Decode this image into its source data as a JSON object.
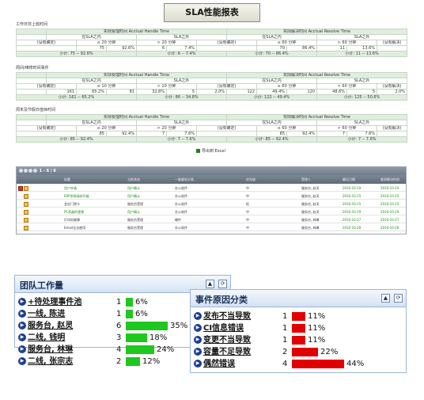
{
  "report": {
    "title": "SLA性能报表",
    "export_label": "导出到 Excel",
    "sections": [
      {
        "heading": "工作日非上班时间",
        "handle_header": "实际受理时间 Acctual Handle Time",
        "resolve_header": "实际解决时间 Acctual Resolve Time",
        "sub": [
          "在SLA之内",
          "SLA之外",
          "在SLA之内",
          "SLA之外"
        ],
        "cols": [
          "(没有确定)",
          "≤ 20 分钟",
          "> 20 分钟",
          "(没有确定)",
          "≤ 60 分钟",
          "> 60 分钟",
          "(没有解决)"
        ],
        "values": [
          "",
          "75",
          "92.6%",
          "6",
          "7.4%",
          "",
          "70",
          "86.4%",
          "11",
          "13.6%",
          ""
        ],
        "totals": [
          "小计: 75 -- 92.6%",
          "小计: 6 -- 7.4%",
          "小计: 70 -- 86.4%",
          "小计: 11 -- 13.6%"
        ]
      },
      {
        "heading": "周间/维修时间事件",
        "handle_header": "实际受理时间 Acctual Handle Time",
        "resolve_header": "实际解决时间 Acctual Resolve Time",
        "sub": [
          "在SLA之内",
          "SLA之外",
          "在SLA之内",
          "SLA之外"
        ],
        "cols": [
          "(没有确定)",
          "≤ 10 分钟",
          "> 10 分钟",
          "(没有确定)",
          "≤ 60 分钟",
          "> 60 分钟",
          "(没有解决)"
        ],
        "values": [
          "",
          "161",
          "65.2%",
          "81",
          "32.8%",
          "5",
          "2.0%",
          "122",
          "49.4%",
          "120",
          "48.6%",
          "5",
          "2.0%"
        ],
        "totals": [
          "小计: 161 -- 65.2%",
          "小计: 86 -- 34.8%",
          "小计: 122 -- 49.4%",
          "小计: 125 -- 50.6%"
        ]
      },
      {
        "heading": "周末及节假日值休时间",
        "handle_header": "实际受理时间 Acctual Handle Time",
        "resolve_header": "实际解决时间 Acctual Resolve Time",
        "sub": [
          "在SLA之内",
          "SLA之外",
          "在SLA之内",
          "SLA之外"
        ],
        "cols": [
          "(没有确定)",
          "≤ 20 分钟",
          "> 20 分钟",
          "(没有确定)",
          "≤ 60 分钟",
          "> 60 分钟",
          "(没有解决)"
        ],
        "values": [
          "",
          "85",
          "92.4%",
          "7",
          "7.6%",
          "",
          "85",
          "92.4%",
          "7",
          "7.6%",
          ""
        ],
        "totals": [
          "小计: 85 -- 92.4%",
          "小计: 7 -- 7.6%",
          "小计: 85 -- 92.4%",
          "小计: 7 -- 7.6%"
        ]
      }
    ]
  },
  "grid": {
    "page_info": "1 - 6 / 6",
    "headers": [
      "标题",
      "当前状态",
      "一级服务分类",
      "优先级",
      "受理人",
      "最后日期",
      "要求解决时间"
    ],
    "rows": [
      {
        "title": "用户申请",
        "status": "用户确认",
        "category": "办公软件",
        "priority": "中",
        "assignee": "服务台, 赵灵",
        "date": "2010-10-19",
        "due": "2010-10-19",
        "green": true
      },
      {
        "title": "ERP系统请求升级",
        "status": "用户确认",
        "category": "办公软件",
        "priority": "中",
        "assignee": "服务台, 赵灵",
        "date": "2010-10-15",
        "due": "2010-10-15",
        "green": true
      },
      {
        "title": "会议门禁卡",
        "status": "服务台受理",
        "category": "办公软件",
        "priority": "低",
        "assignee": "服务台, 赵灵",
        "date": "2010-10-15",
        "due": "2010-10-15",
        "green": false
      },
      {
        "title": "PC机器的更换",
        "status": "用户确认",
        "category": "办公软件",
        "priority": "中",
        "assignee": "服务台, 赵灵",
        "date": "2010-10-19",
        "due": "2010-10-19",
        "green": true
      },
      {
        "title": "打印机故障",
        "status": "服务台受理",
        "category": "硬件",
        "priority": "中",
        "assignee": "服务台, 林琳",
        "date": "2010-10-27",
        "due": "2010-10-27",
        "green": false
      },
      {
        "title": "Email无法使用",
        "status": "服务台受理",
        "category": "办公软件",
        "priority": "中",
        "assignee": "服务台, 林琳",
        "date": "2010-10-28",
        "due": "2010-10-28",
        "green": false
      }
    ]
  },
  "team": {
    "title": "团队工作量",
    "bar_color": "#1ec81e",
    "items": [
      {
        "label": "+待处理事件池",
        "count": "1",
        "pct": "6%",
        "fraction": 0.06
      },
      {
        "label": "一线, 陈进",
        "count": "1",
        "pct": "6%",
        "fraction": 0.06
      },
      {
        "label": "服务台, 赵灵",
        "count": "6",
        "pct": "35%",
        "fraction": 0.35
      },
      {
        "label": "二线, 钱明",
        "count": "3",
        "pct": "18%",
        "fraction": 0.18
      },
      {
        "label": "服务台, 林琳",
        "count": "4",
        "pct": "24%",
        "fraction": 0.24
      },
      {
        "label": "二线, 张宗志",
        "count": "2",
        "pct": "12%",
        "fraction": 0.12
      }
    ]
  },
  "cause": {
    "title": "事件原因分类",
    "bar_color": "#e00000",
    "items": [
      {
        "label": "发布不当导致",
        "count": "1",
        "pct": "11%",
        "fraction": 0.11
      },
      {
        "label": "CI信息错误",
        "count": "1",
        "pct": "11%",
        "fraction": 0.11
      },
      {
        "label": "变更不当导致",
        "count": "1",
        "pct": "11%",
        "fraction": 0.11
      },
      {
        "label": "容量不足导致",
        "count": "2",
        "pct": "22%",
        "fraction": 0.22
      },
      {
        "label": "偶然错误",
        "count": "4",
        "pct": "44%",
        "fraction": 0.44
      }
    ]
  }
}
